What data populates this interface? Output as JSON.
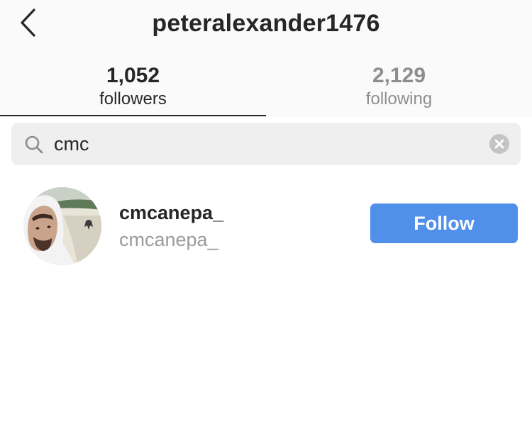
{
  "header": {
    "title": "peteralexander1476",
    "back_icon": "chevron-left-icon"
  },
  "tabs": [
    {
      "count": "1,052",
      "label": "followers",
      "active": true
    },
    {
      "count": "2,129",
      "label": "following",
      "active": false
    }
  ],
  "search": {
    "value": "cmc",
    "icon": "search-icon",
    "clear_icon": "clear-icon"
  },
  "results": [
    {
      "username": "cmcanepa_",
      "full_name": "cmcanepa_",
      "button_label": "Follow",
      "avatar": "avatar"
    }
  ],
  "colors": {
    "accent": "#5090ea",
    "header_bg": "#fafafa",
    "search_bg": "#efefef",
    "text_primary": "#262626",
    "text_secondary": "#8e8e8e"
  }
}
